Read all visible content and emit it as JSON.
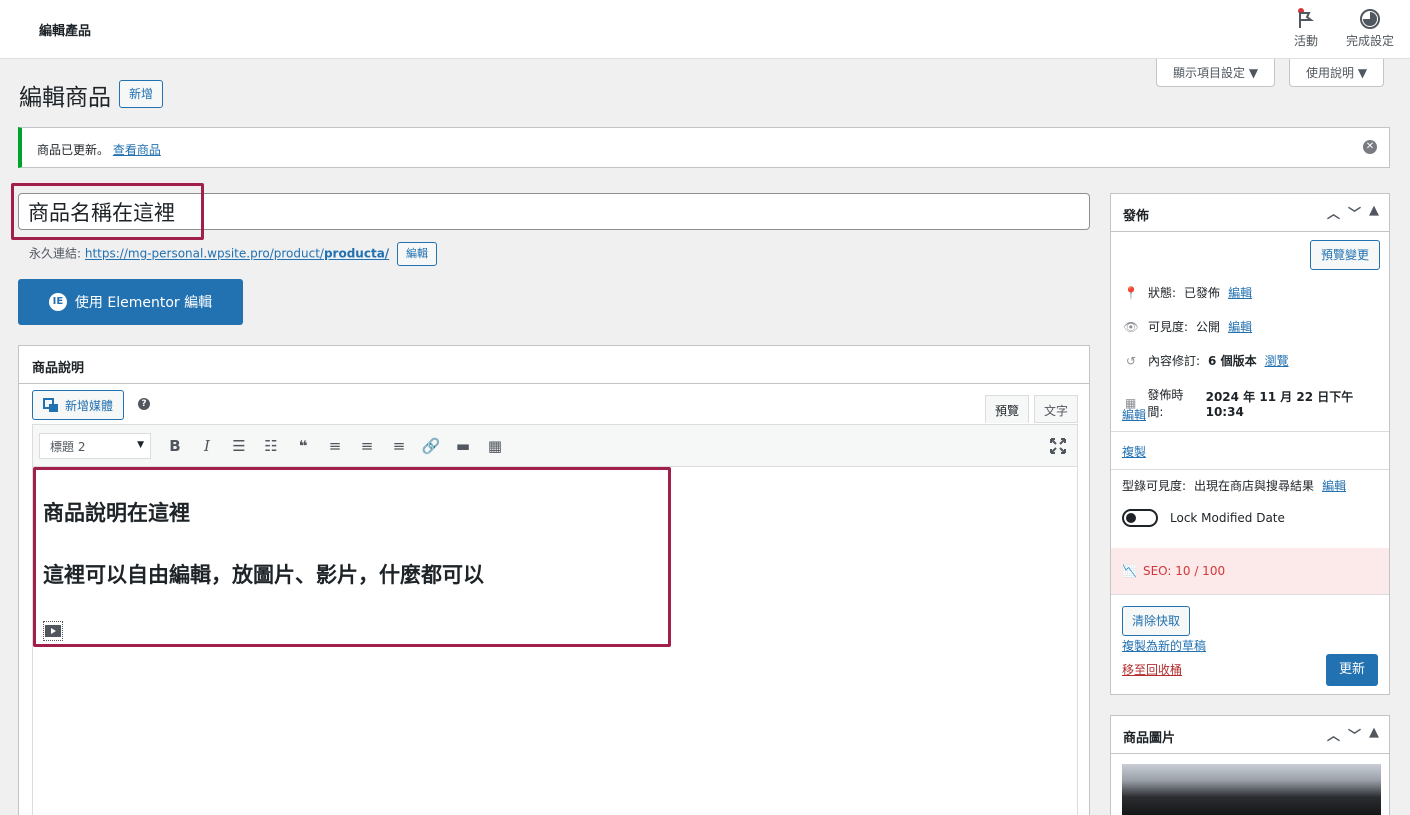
{
  "topbar": {
    "title": "編輯產品",
    "activity_label": "活動",
    "setup_label": "完成設定"
  },
  "screen_options": {
    "display_label": "顯示項目設定 ▼",
    "help_label": "使用說明 ▼"
  },
  "heading": {
    "title": "編輯商品",
    "add_new": "新增"
  },
  "notice": {
    "text": "商品已更新。",
    "link": "查看商品"
  },
  "product": {
    "title_value": "商品名稱在這裡",
    "permalink_label": "永久連結:",
    "permalink_base": "https://mg-personal.wpsite.pro/product/",
    "permalink_slug": "producta/",
    "edit_btn": "編輯"
  },
  "elementor": {
    "label": "使用 Elementor 編輯",
    "icon": "elementor-icon"
  },
  "description": {
    "heading": "商品說明",
    "add_media": "新增媒體",
    "tab_visual": "預覽",
    "tab_text": "文字",
    "format_select": "標題 2",
    "lines": [
      "商品說明在這裡",
      "這裡可以自由編輯，放圖片、影片，什麼都可以"
    ]
  },
  "publish": {
    "heading": "發佈",
    "preview_btn": "預覽變更",
    "status_label": "狀態:",
    "status_value": "已發佈",
    "visibility_label": "可見度:",
    "visibility_value": "公開",
    "revisions_label": "內容修訂:",
    "revisions_value": "6 個版本",
    "revisions_link": "瀏覽",
    "publish_time_label": "發佈時間:",
    "publish_time_value": "2024 年 11 月 22 日下午 10:34",
    "edit_link": "編輯",
    "duplicate_link": "複製",
    "catalog_label": "型錄可見度:",
    "catalog_value": "出現在商店與搜尋結果",
    "lock_label": "Lock Modified Date",
    "seo_label": "SEO: 10 / 100",
    "clear_cache": "清除快取",
    "copy_draft": "複製為新的草稿",
    "trash": "移至回收桶",
    "update": "更新"
  },
  "product_image": {
    "heading": "商品圖片"
  },
  "colors": {
    "primary": "#2271b1",
    "highlight": "#a0204a",
    "success": "#00a32a",
    "danger": "#d63638"
  }
}
